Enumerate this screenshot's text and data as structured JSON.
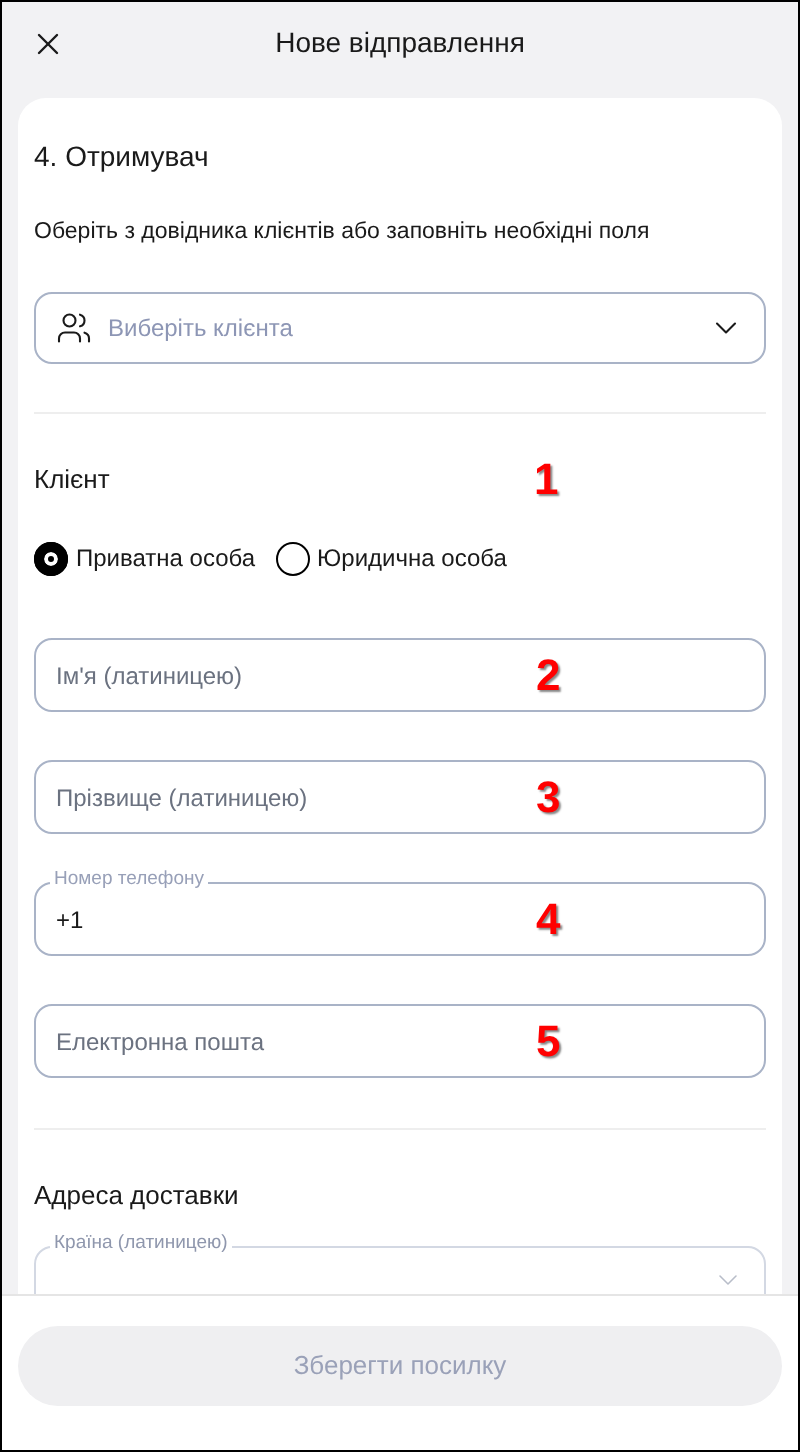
{
  "header": {
    "title": "Нове відправлення"
  },
  "section": {
    "title": "4. Отримувач",
    "hint": "Оберіть з довідника клієнтів або заповніть необхідні поля"
  },
  "client_select": {
    "placeholder": "Виберіть клієнта"
  },
  "client": {
    "title": "Клієнт",
    "annotation": "1",
    "types": [
      {
        "label": "Приватна особа",
        "selected": true
      },
      {
        "label": "Юридична особа",
        "selected": false
      }
    ]
  },
  "fields": [
    {
      "placeholder": "Ім'я (латиницею)",
      "annotation": "2"
    },
    {
      "placeholder": "Прізвище (латиницею)",
      "annotation": "3"
    },
    {
      "label": "Номер телефону",
      "value": "+1",
      "annotation": "4"
    },
    {
      "placeholder": "Електронна пошта",
      "annotation": "5"
    }
  ],
  "delivery": {
    "title": "Адреса доставки",
    "country_label": "Країна (латиницею)"
  },
  "footer": {
    "button": "Зберегти посилку"
  }
}
